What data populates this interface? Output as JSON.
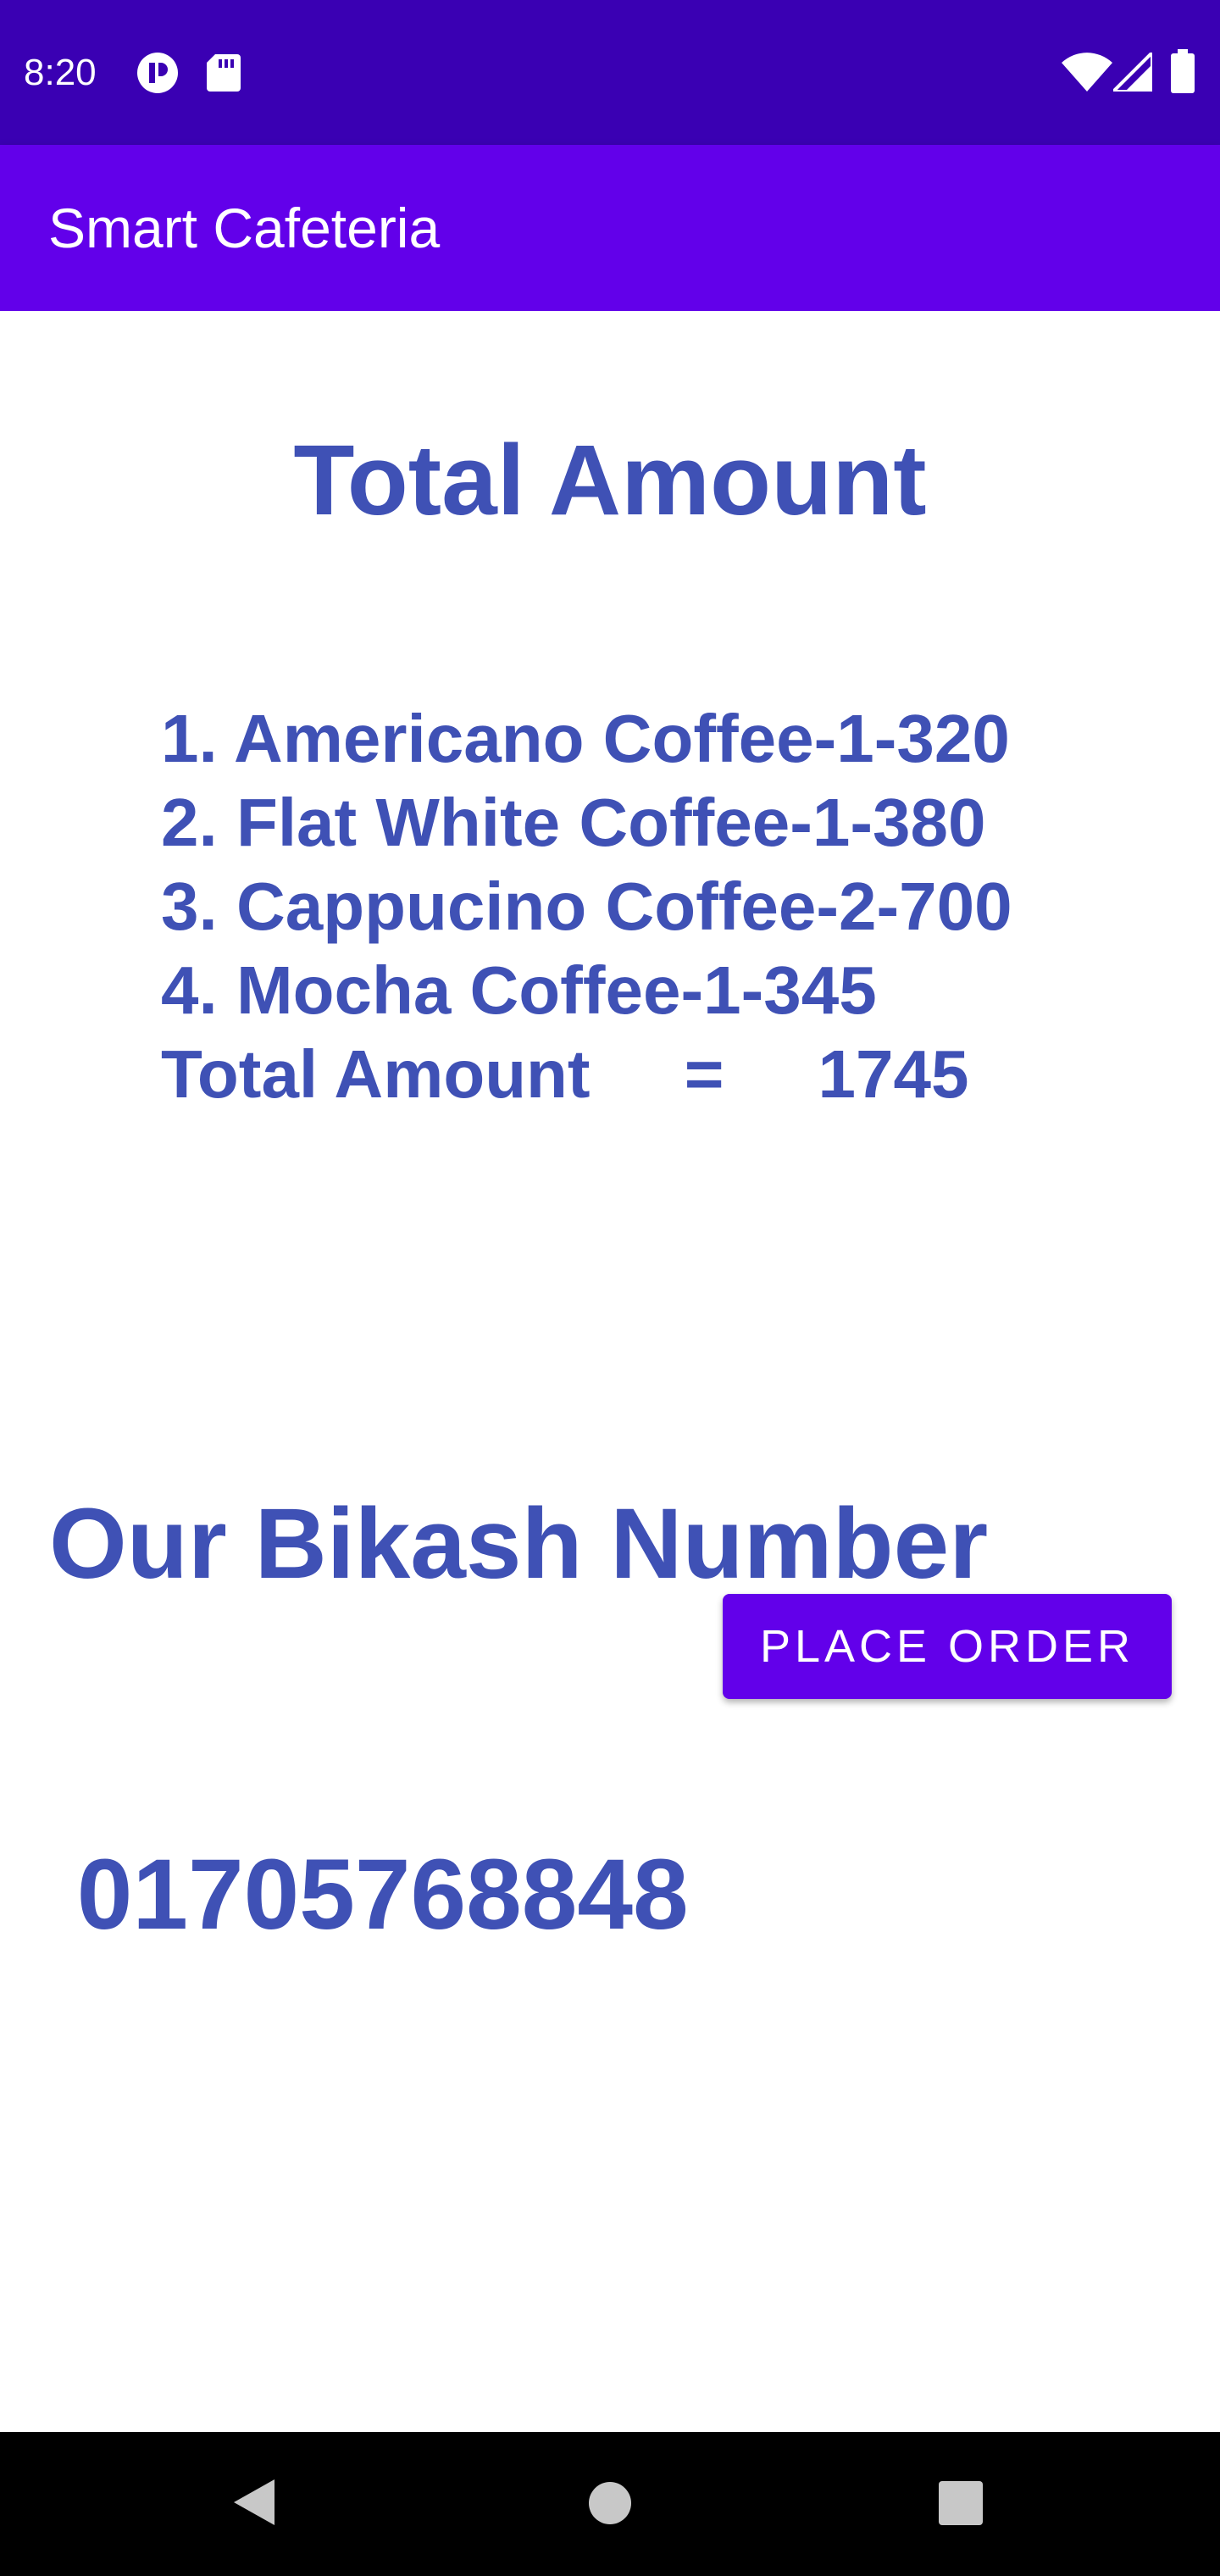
{
  "status_bar": {
    "time": "8:20",
    "icons_left": [
      "app-notification-icon",
      "sd-card-icon"
    ],
    "icons_right": [
      "wifi-icon",
      "signal-icon",
      "battery-icon"
    ]
  },
  "app_bar": {
    "title": "Smart Cafeteria"
  },
  "main": {
    "heading": "Total Amount",
    "order_lines": [
      "1. Americano Coffee-1-320",
      "2. Flat White Coffee-1-380",
      "3. Cappucino Coffee-2-700",
      "4. Mocha Coffee-1-345",
      "Total Amount     =     1745"
    ],
    "bikash_label": "Our Bikash Number",
    "bikash_number": " 01705768848",
    "place_order_label": "PLACE ORDER"
  },
  "nav_bar": {
    "buttons": [
      "back-icon",
      "home-icon",
      "recents-icon"
    ]
  },
  "colors": {
    "status_bar": "#3a00b3",
    "app_bar": "#6200ea",
    "text_primary": "#3f51b5",
    "button": "#6200ea"
  }
}
